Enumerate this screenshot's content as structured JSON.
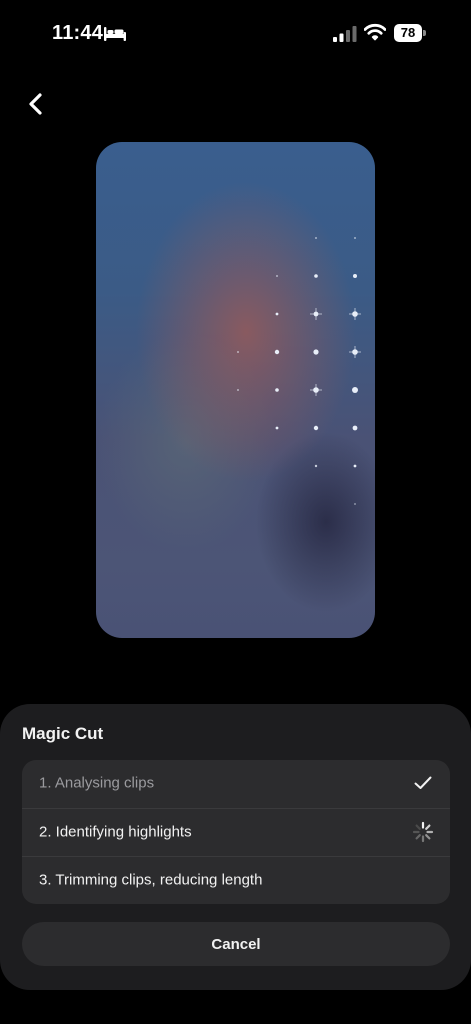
{
  "status_bar": {
    "time": "11:44",
    "battery": "78",
    "icons": [
      "bed-icon",
      "cellular-signal-icon",
      "wifi-icon",
      "battery-icon"
    ]
  },
  "nav": {
    "back_icon": "chevron-left-icon"
  },
  "sheet": {
    "title": "Magic Cut",
    "steps": [
      {
        "label": "1. Analysing clips",
        "state": "done",
        "icon": "checkmark-icon"
      },
      {
        "label": "2. Identifying highlights",
        "state": "in-progress",
        "icon": "spinner-icon"
      },
      {
        "label": "3. Trimming clips, reducing length",
        "state": "pending",
        "icon": ""
      }
    ],
    "cancel_label": "Cancel"
  },
  "colors": {
    "background": "#000000",
    "sheet": "#1d1d1f",
    "card": "#2c2c2e",
    "text_primary": "#f2f2f2",
    "text_muted": "#9b9b9f"
  }
}
